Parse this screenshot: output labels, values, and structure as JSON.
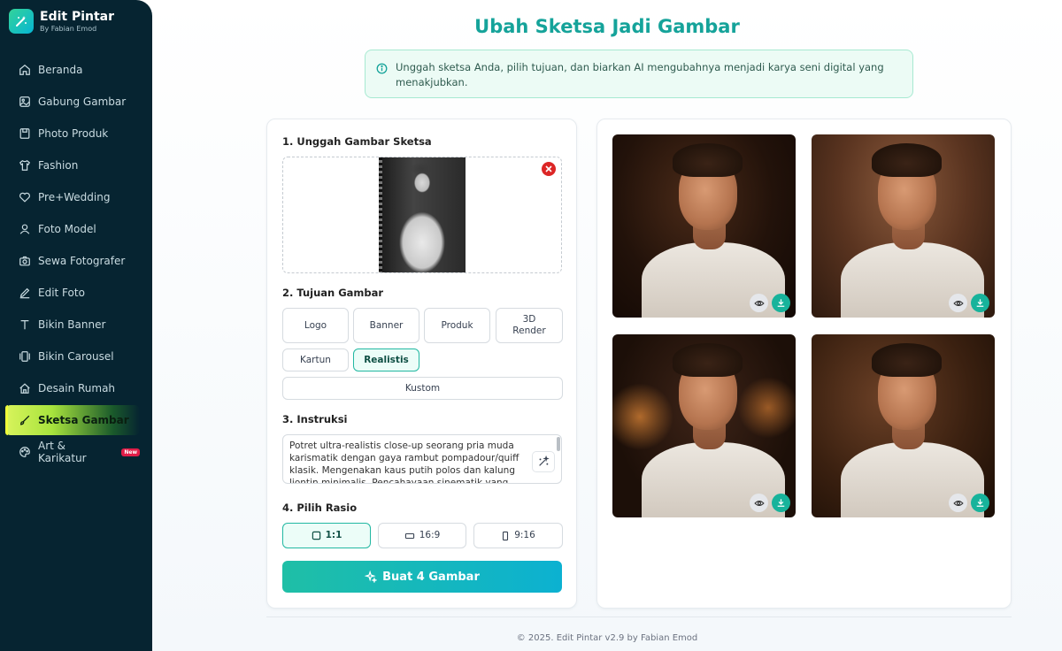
{
  "brand": {
    "title": "Edit Pintar",
    "subtitle": "By Fabian Emod"
  },
  "sidebar": {
    "items": [
      {
        "label": "Beranda",
        "icon": "home-icon"
      },
      {
        "label": "Gabung Gambar",
        "icon": "image-icon"
      },
      {
        "label": "Photo Produk",
        "icon": "package-icon"
      },
      {
        "label": "Fashion",
        "icon": "shirt-icon"
      },
      {
        "label": "Pre+Wedding",
        "icon": "heart-icon"
      },
      {
        "label": "Foto Model",
        "icon": "user-icon"
      },
      {
        "label": "Sewa Fotografer",
        "icon": "camera-icon"
      },
      {
        "label": "Edit Foto",
        "icon": "pencil-icon"
      },
      {
        "label": "Bikin Banner",
        "icon": "type-icon"
      },
      {
        "label": "Bikin Carousel",
        "icon": "carousel-icon"
      },
      {
        "label": "Desain Rumah",
        "icon": "house-icon"
      },
      {
        "label": "Sketsa Gambar",
        "icon": "brush-icon",
        "active": true
      },
      {
        "label": "Art & Karikatur",
        "icon": "palette-icon",
        "badge": "New"
      }
    ]
  },
  "main": {
    "title": "Ubah Sketsa Jadi Gambar",
    "info": "Unggah sketsa Anda, pilih tujuan, dan biarkan AI mengubahnya menjadi karya seni digital yang menakjubkan."
  },
  "form": {
    "upload_title": "1. Unggah Gambar Sketsa",
    "purpose_title": "2. Tujuan Gambar",
    "purposes": [
      "Logo",
      "Banner",
      "Produk",
      "3D Render",
      "Kartun",
      "Realistis",
      "Kustom"
    ],
    "selected_purpose": "Realistis",
    "instruction_title": "3. Instruksi",
    "instruction_text": "Potret ultra-realistis close-up seorang pria muda karismatik dengan gaya rambut pompadour/quiff klasik. Mengenakan kaus putih polos dan kalung liontin minimalis. Pencahayaan sinematik yang kuat",
    "ratio_title": "4. Pilih Rasio",
    "ratios": [
      "1:1",
      "16:9",
      "9:16"
    ],
    "selected_ratio": "1:1",
    "generate_label": "Buat 4 Gambar"
  },
  "footer": "© 2025. Edit Pintar v2.9 by Fabian Emod",
  "colors": {
    "accent": "#15a39a",
    "sidebar_bg": "#062431",
    "active_nav": "#a7e33d",
    "danger": "#dc2626"
  }
}
